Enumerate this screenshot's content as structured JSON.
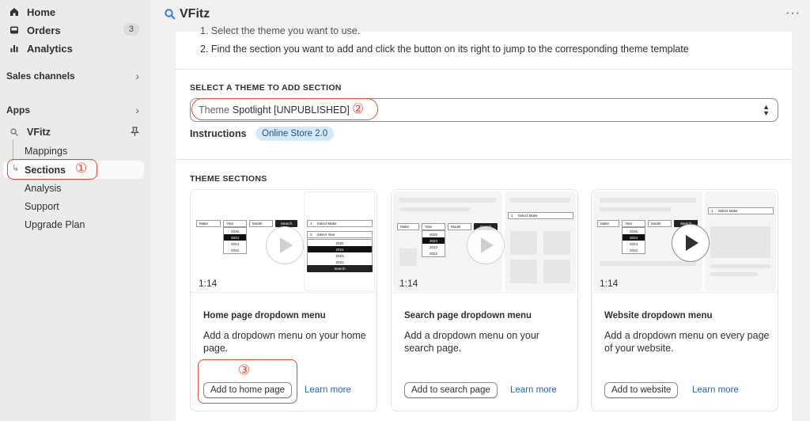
{
  "sidebar": {
    "home": "Home",
    "orders": "Orders",
    "orders_count": "3",
    "analytics": "Analytics",
    "sales_channels": "Sales channels",
    "apps": "Apps",
    "app_name": "VFitz",
    "sub_items": [
      "Mappings",
      "Sections",
      "Analysis",
      "Support",
      "Upgrade Plan"
    ],
    "active_item": "Sections"
  },
  "header": {
    "title": "VFitz",
    "more": "···"
  },
  "annotations": {
    "n1": "①",
    "n2": "②",
    "n3": "③",
    "color": "#e34a33"
  },
  "steps": {
    "step1": "1. Select the theme you want to use.",
    "step2": "2. Find the section you want to add and click the button on its right to jump to the corresponding theme template"
  },
  "theme_select": {
    "heading": "SELECT A THEME TO ADD SECTION",
    "prefix": "Theme",
    "value": "Spotlight [UNPUBLISHED]"
  },
  "instructions": {
    "label": "Instructions",
    "badge": "Online Store 2.0"
  },
  "theme_sections": {
    "heading": "THEME SECTIONS",
    "cards": [
      {
        "title": "Home page dropdown menu",
        "desc": "Add a dropdown menu on your home page.",
        "button": "Add to home page",
        "link": "Learn more",
        "duration": "1:14"
      },
      {
        "title": "Search page dropdown menu",
        "desc": "Add a dropdown menu on your search page.",
        "button": "Add to search page",
        "link": "Learn more",
        "duration": "1:14"
      },
      {
        "title": "Website dropdown menu",
        "desc": "Add a dropdown menu on every page of your website.",
        "button": "Add to website",
        "link": "Learn more",
        "duration": "1:14"
      }
    ],
    "mini": {
      "make": "Make",
      "year": "Year",
      "model": "Model",
      "search": "Search",
      "years": [
        "2025",
        "2024",
        "2023",
        "2022"
      ],
      "step1": "1",
      "step2": "2",
      "select_make": "Select Make",
      "select_year": "Select Year"
    }
  },
  "colors": {
    "link": "#2463c4",
    "badge_bg": "#d6e9fb",
    "accent": "#e34a33"
  }
}
